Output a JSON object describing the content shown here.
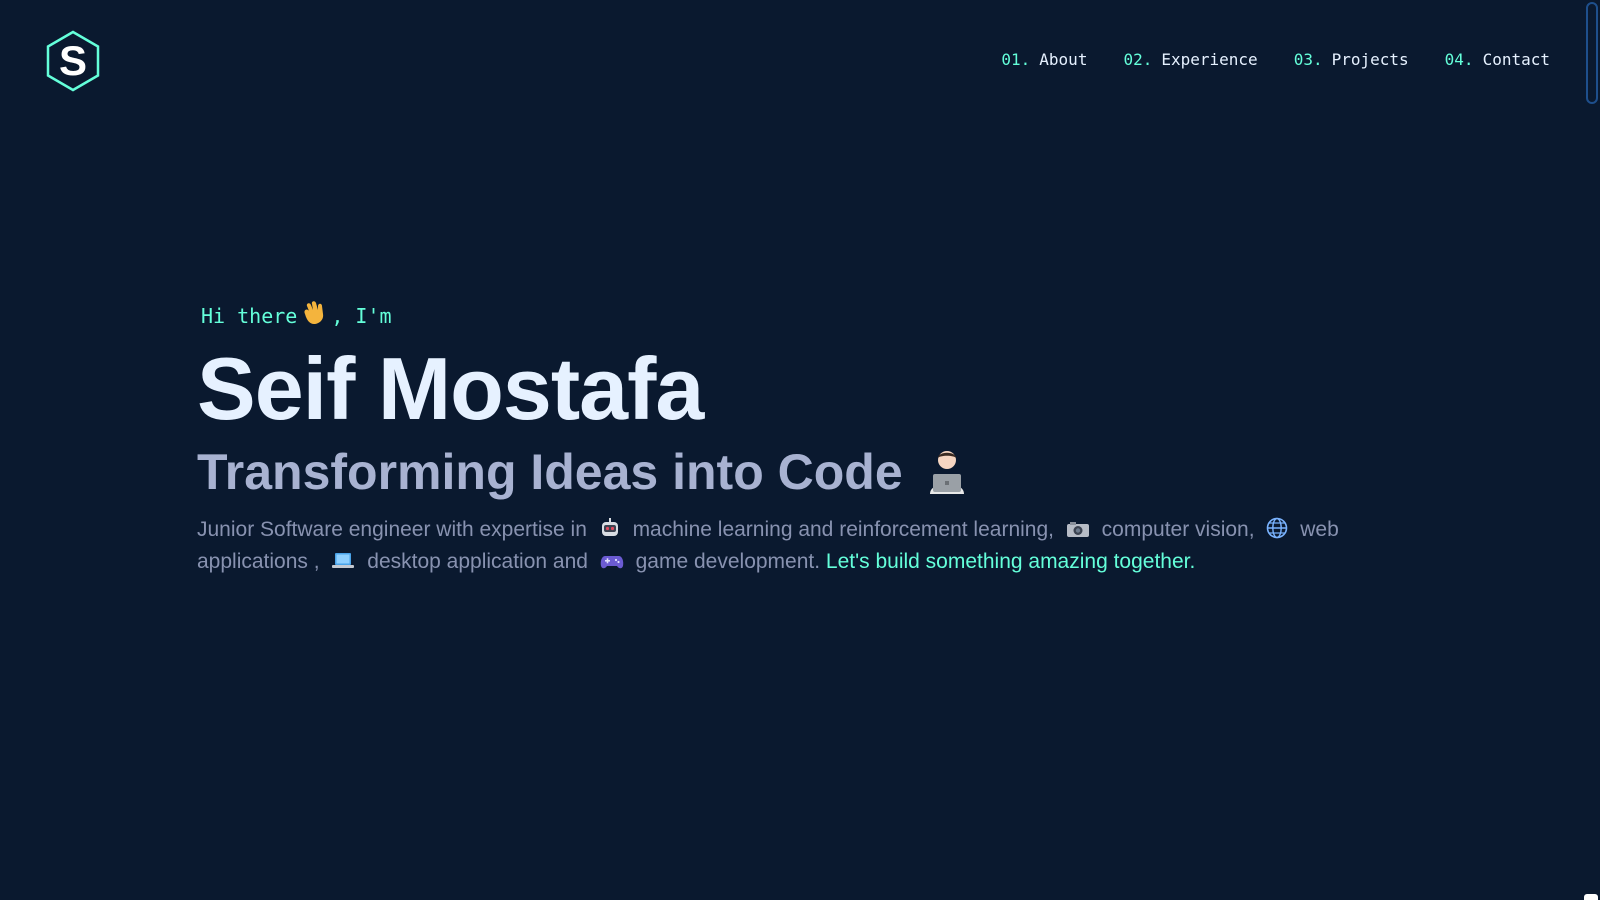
{
  "logo": {
    "letter": "S",
    "color": "#64ffda"
  },
  "nav": {
    "items": [
      {
        "num": "01.",
        "label": "About"
      },
      {
        "num": "02.",
        "label": "Experience"
      },
      {
        "num": "03.",
        "label": "Projects"
      },
      {
        "num": "04.",
        "label": "Contact"
      }
    ]
  },
  "hero": {
    "greeting_before": "Hi there",
    "greeting_after": ", I'm",
    "name": "Seif Mostafa",
    "tagline": "Transforming Ideas into Code",
    "desc": {
      "p1": "Junior Software engineer with expertise in",
      "p2": "machine learning and reinforcement learning,",
      "p3": "computer vision,",
      "p4": "web applications ,",
      "p5": "desktop application and",
      "p6": "game development.",
      "cta": "Let's build something amazing together."
    }
  },
  "icons": {
    "wave": "waving-hand-icon",
    "technologist": "technologist-icon",
    "robot": "robot-icon",
    "camera": "camera-icon",
    "globe": "globe-icon",
    "laptop": "laptop-icon",
    "gamepad": "gamepad-icon"
  },
  "colors": {
    "background": "#0a192f",
    "accent": "#64ffda",
    "heading": "#e6f1ff",
    "subheading": "#a8b2d1",
    "body": "#8892b0"
  }
}
